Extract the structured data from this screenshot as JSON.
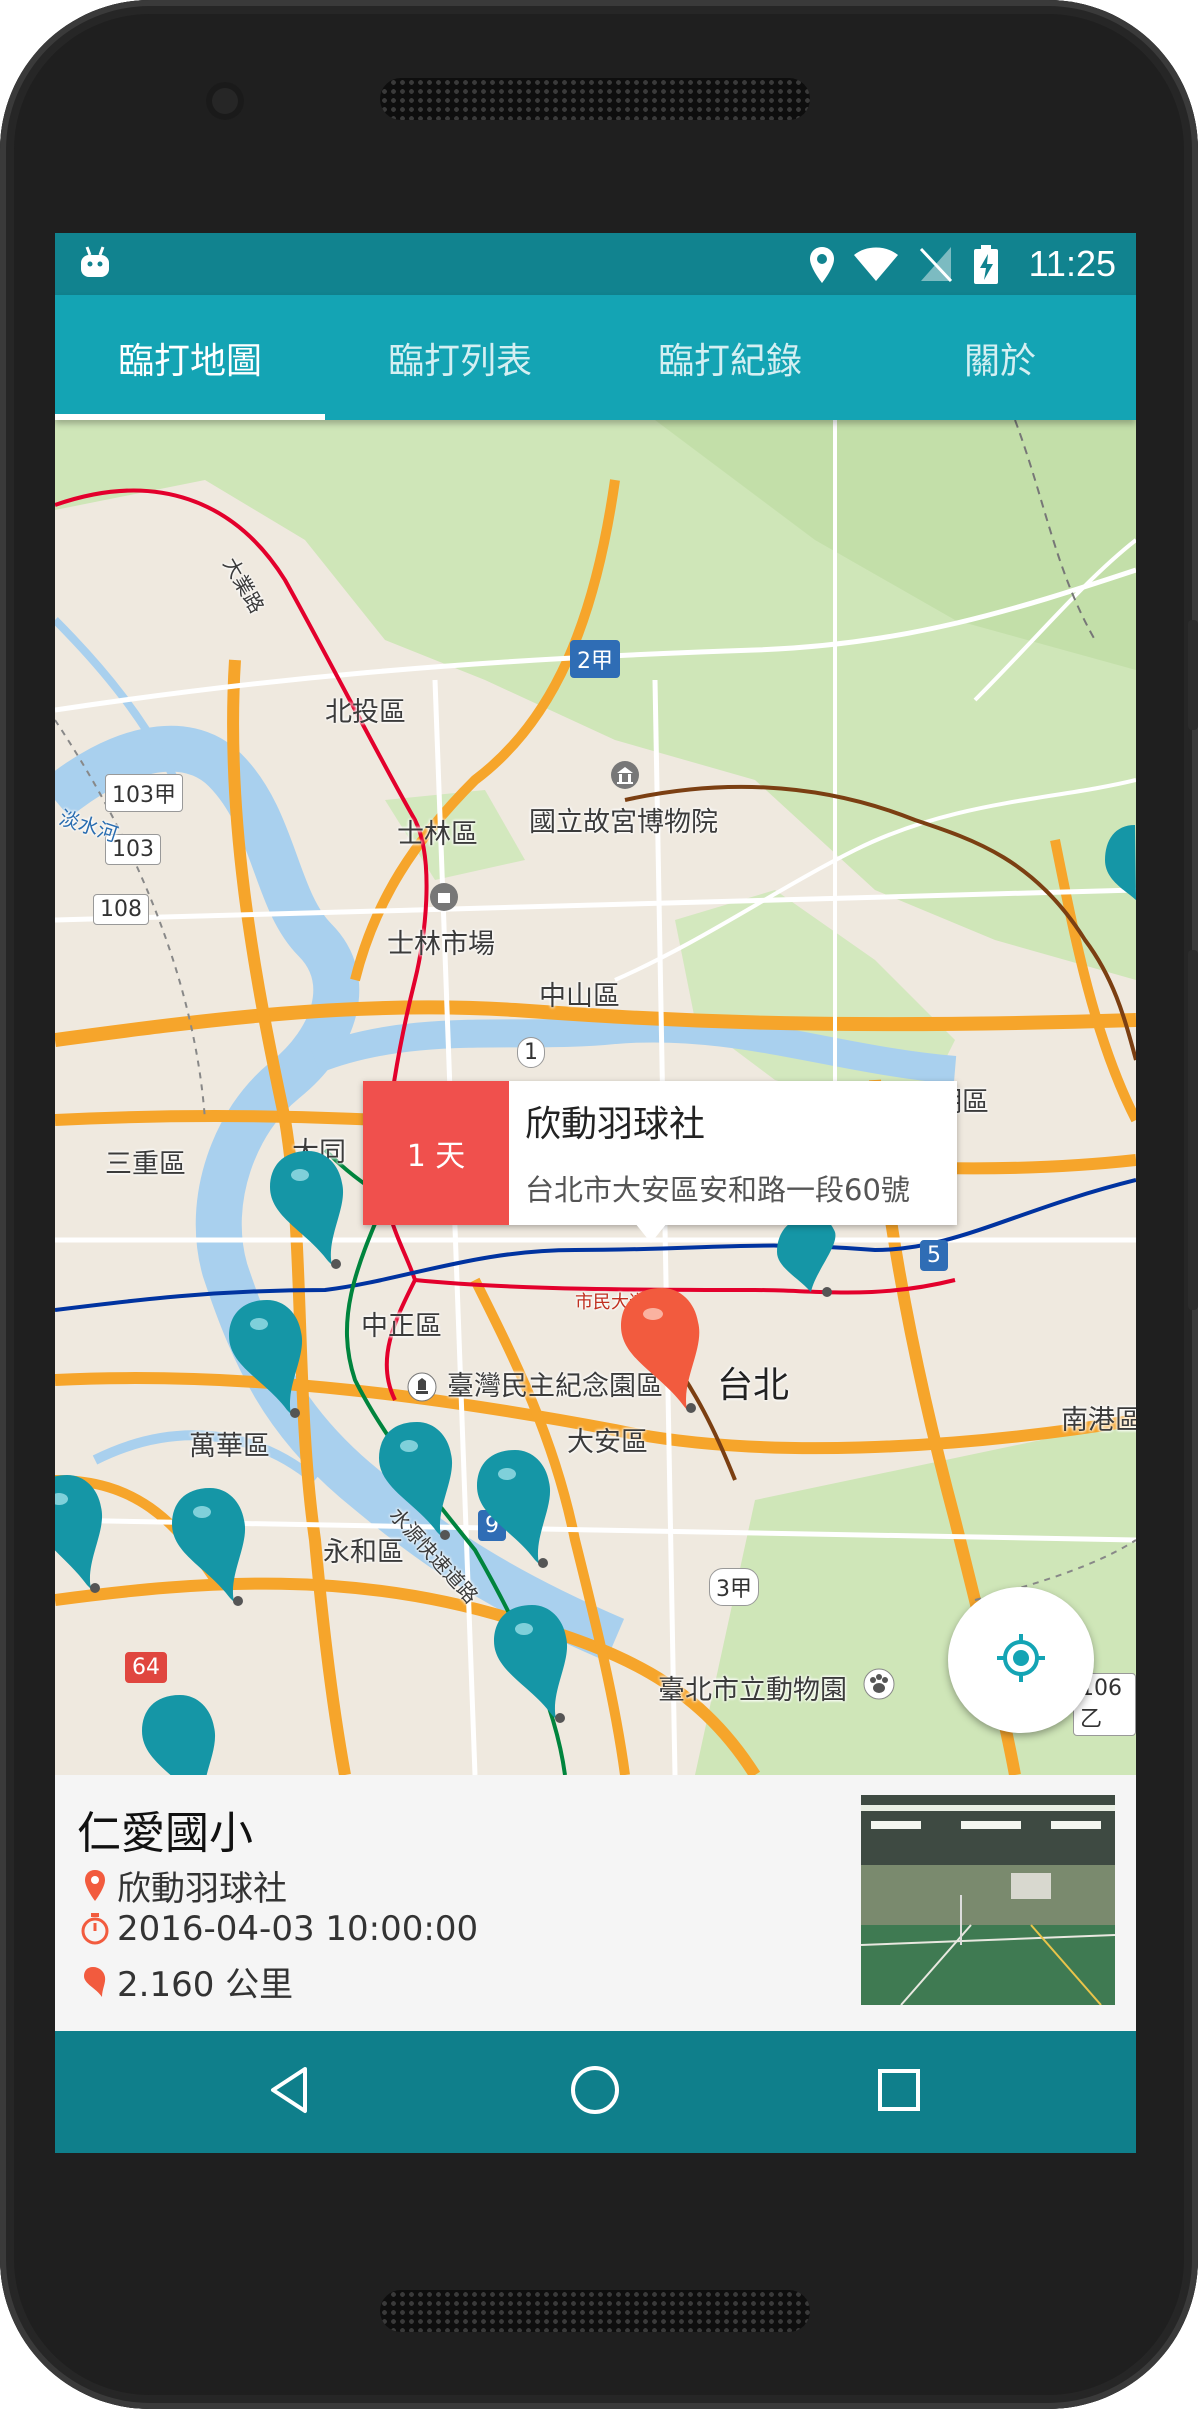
{
  "status_bar": {
    "time": "11:25",
    "icons": [
      "android-icon",
      "location-pin-icon",
      "wifi-icon",
      "no-signal-icon",
      "battery-charging-icon"
    ]
  },
  "tabs": [
    {
      "label": "臨打地圖",
      "active": true
    },
    {
      "label": "臨打列表",
      "active": false
    },
    {
      "label": "臨打紀錄",
      "active": false
    },
    {
      "label": "關於",
      "active": false
    }
  ],
  "map": {
    "labels": {
      "beitou": "北投區",
      "shilin": "士林區",
      "shilin_market": "士林市場",
      "museum": "國立故宮博物院",
      "zhongshan": "中山區",
      "neihu": "內湖區",
      "sanchong": "三重區",
      "datong": "大同",
      "zhongzheng": "中正區",
      "wanhua": "萬華區",
      "memorial": "臺灣民主紀念園區",
      "daan": "大安區",
      "taipei": "台北",
      "nangang": "南港區",
      "yonghe": "永和區",
      "zoo": "臺北市立動物園",
      "river": "淡水河",
      "dayehroad": "大業路",
      "expressway": "水源快速道路",
      "shimin": "市民大道路"
    },
    "shields": [
      "2甲",
      "103甲",
      "103",
      "108",
      "1",
      "5",
      "9",
      "3甲",
      "64",
      "106乙"
    ],
    "colors": {
      "land": "#efe9df",
      "park": "#cfe6b8",
      "water": "#a9d0ee",
      "highway": "#f6a52b",
      "metro_red": "#e3002c",
      "metro_blue": "#0033a0",
      "metro_green": "#00843d",
      "marker_teal": "#1596a6",
      "marker_selected": "#f25b3e"
    }
  },
  "info_window": {
    "days": "1 天",
    "title": "欣動羽球社",
    "address": "台北市大安區安和路一段60號"
  },
  "detail_card": {
    "title": "仁愛國小",
    "club": "欣動羽球社",
    "datetime": "2016-04-03 10:00:00",
    "distance": "2.160 公里"
  },
  "nav_bar": {
    "buttons": [
      "back-icon",
      "home-icon",
      "recents-icon"
    ]
  }
}
